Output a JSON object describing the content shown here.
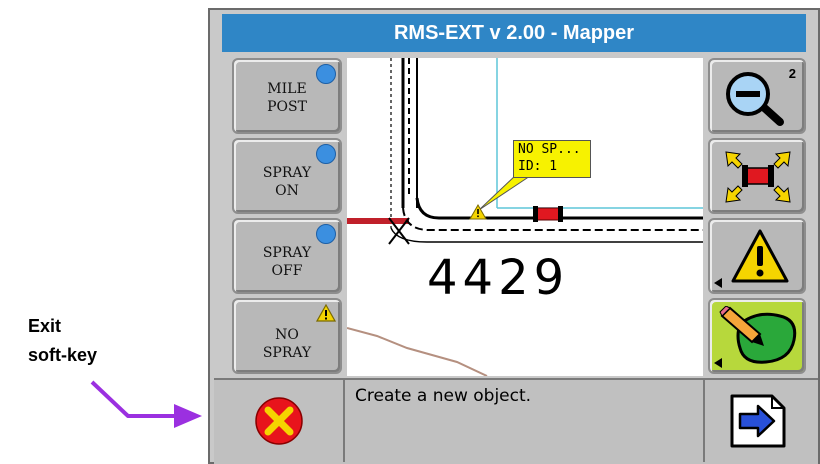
{
  "annotation": {
    "line1": "Exit",
    "line2": "soft-key"
  },
  "window": {
    "title": "RMS-EXT v 2.00 - Mapper"
  },
  "left_softkeys": [
    {
      "line1": "MILE",
      "line2": "POST",
      "indicator": "blue-dot"
    },
    {
      "line1": "SPRAY",
      "line2": "ON",
      "indicator": "blue-dot"
    },
    {
      "line1": "SPRAY",
      "line2": "OFF",
      "indicator": "blue-dot"
    },
    {
      "line1": "NO",
      "line2": "SPRAY",
      "indicator": "warning"
    }
  ],
  "right_softkeys": {
    "zoom_level": "2",
    "zoom_icon": "zoom-out-icon",
    "fit_icon": "zoom-to-vehicle-icon",
    "warning_icon": "warning-icon",
    "edit_icon": "edit-area-icon"
  },
  "map": {
    "tooltip_line1": "NO SP...",
    "tooltip_line2": "ID: 1",
    "road_number": "4429"
  },
  "bottom": {
    "message": "Create a new object."
  },
  "colors": {
    "titlebar": "#2f86c6",
    "annotation_arrow": "#9b30e0",
    "exit_red": "#e8141c",
    "exit_x": "#f5d400"
  }
}
